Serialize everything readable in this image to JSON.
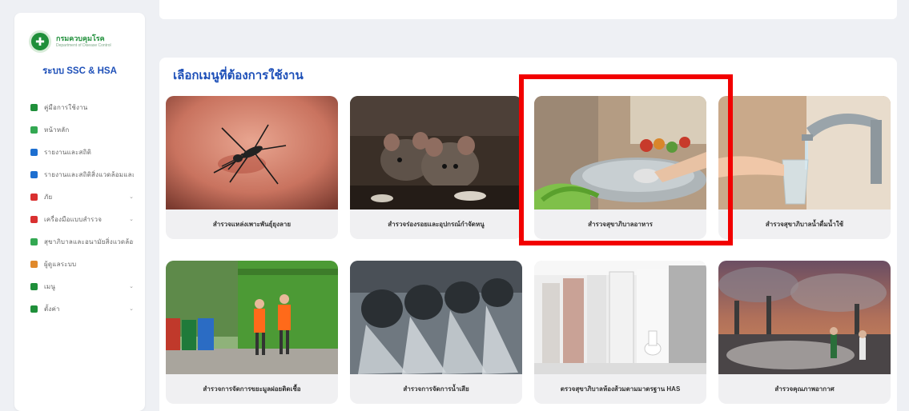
{
  "sidebar": {
    "logo_text": "กรมควบคุมโรค",
    "logo_subtext": "Department of Disease Control",
    "system_title": "ระบบ SSC & HSA",
    "items": [
      {
        "label": "คู่มือการใช้งาน",
        "icon": "book-icon",
        "color": "#1f8f3a",
        "has_chevron": false
      },
      {
        "label": "หน้าหลัก",
        "icon": "grid-icon",
        "color": "#33a852",
        "has_chevron": false
      },
      {
        "label": "รายงานและสถิติ",
        "icon": "bar-chart-icon",
        "color": "#1d6fd0",
        "has_chevron": false
      },
      {
        "label": "รายงานและสถิติสิ่งแวดล้อมและสุขาภิบาล",
        "icon": "bar-chart-icon",
        "color": "#1d6fd0",
        "has_chevron": false
      },
      {
        "label": "ภัย",
        "icon": "hazard-icon",
        "color": "#d93030",
        "has_chevron": true
      },
      {
        "label": "เครื่องมือแบบสำรวจ",
        "icon": "tools-icon",
        "color": "#d93030",
        "has_chevron": true
      },
      {
        "label": "สุขาภิบาลและอนามัยสิ่งแวดล้อม",
        "icon": "monitor-icon",
        "color": "#33a852",
        "has_chevron": false
      },
      {
        "label": "ผู้ดูแลระบบ",
        "icon": "user-icon",
        "color": "#e0892b",
        "has_chevron": false
      },
      {
        "label": "เมนู",
        "icon": "list-icon",
        "color": "#1f8f3a",
        "has_chevron": true
      },
      {
        "label": "ตั้งค่า",
        "icon": "gear-icon",
        "color": "#1f8f3a",
        "has_chevron": true
      }
    ]
  },
  "main": {
    "section_title": "เลือกเมนูที่ต้องการใช้งาน",
    "cards": [
      {
        "label": "สำรวจแหล่งเพาะพันธุ์ยุงลาย",
        "image": "mosquito-image"
      },
      {
        "label": "สำรวจร่องรอยและอุปกรณ์กำจัดหนู",
        "image": "rats-image"
      },
      {
        "label": "สำรวจสุขาภิบาลอาหาร",
        "image": "food-washing-image"
      },
      {
        "label": "สำรวจสุขาภิบาลน้ำดื่มน้ำใช้",
        "image": "tap-water-image"
      },
      {
        "label": "สำรวจการจัดการขยะมูลฝอยติดเชื้อ",
        "image": "garbage-truck-image"
      },
      {
        "label": "สำรวจการจัดการน้ำเสีย",
        "image": "wastewater-pipes-image"
      },
      {
        "label": "ตรวจสุขาภิบาลห้องส้วมตามมาตรฐาน HAS",
        "image": "restroom-image"
      },
      {
        "label": "สำรวจคุณภาพอากาศ",
        "image": "air-pollution-image"
      }
    ]
  },
  "colors": {
    "accent_blue": "#1d4fb8",
    "brand_green": "#1f8f3a",
    "highlight_red": "#f20000"
  }
}
